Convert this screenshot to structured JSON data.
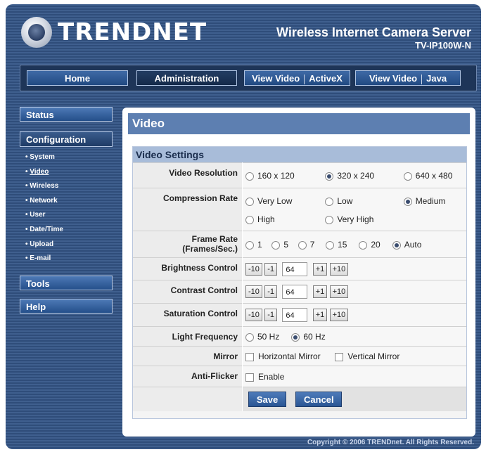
{
  "header": {
    "logo_text": "TRENDNET",
    "product_name": "Wireless Internet Camera Server",
    "model": "TV-IP100W-N"
  },
  "topnav": {
    "home": "Home",
    "administration": "Administration",
    "view_video": "View Video",
    "activex": "ActiveX",
    "java": "Java"
  },
  "sidebar": {
    "status": "Status",
    "configuration": "Configuration",
    "tools": "Tools",
    "help": "Help",
    "items": [
      "System",
      "Video",
      "Wireless",
      "Network",
      "User",
      "Date/Time",
      "Upload",
      "E-mail"
    ]
  },
  "page": {
    "title": "Video",
    "section": "Video Settings"
  },
  "fields": {
    "resolution": {
      "label": "Video Resolution",
      "options": [
        "160 x 120",
        "320 x 240",
        "640 x 480"
      ],
      "selected": "320 x 240"
    },
    "compression": {
      "label": "Compression Rate",
      "options": [
        "Very Low",
        "Low",
        "Medium",
        "High",
        "Very High"
      ],
      "selected": "Medium"
    },
    "framerate": {
      "label_1": "Frame Rate",
      "label_2": "(Frames/Sec.)",
      "options": [
        "1",
        "5",
        "7",
        "15",
        "20",
        "Auto"
      ],
      "selected": "Auto"
    },
    "brightness": {
      "label": "Brightness Control",
      "value": "64"
    },
    "contrast": {
      "label": "Contrast Control",
      "value": "64"
    },
    "saturation": {
      "label": "Saturation Control",
      "value": "64"
    },
    "step": {
      "minus10": "-10",
      "minus1": "-1",
      "plus1": "+1",
      "plus10": "+10"
    },
    "light": {
      "label": "Light Frequency",
      "options": [
        "50 Hz",
        "60 Hz"
      ],
      "selected": "60 Hz"
    },
    "mirror": {
      "label": "Mirror",
      "horizontal": "Horizontal Mirror",
      "vertical": "Vertical Mirror"
    },
    "antiflicker": {
      "label": "Anti-Flicker",
      "enable": "Enable"
    }
  },
  "buttons": {
    "save": "Save",
    "cancel": "Cancel"
  },
  "footer": {
    "copyright": "Copyright © 2006 TRENDnet. All Rights Reserved."
  }
}
